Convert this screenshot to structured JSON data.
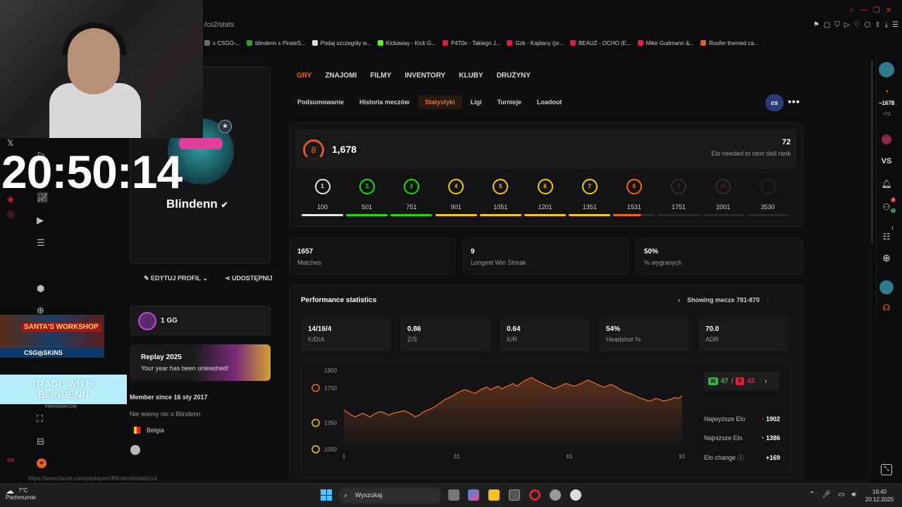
{
  "browser": {
    "address": "/cs2/stats",
    "bookmarks": [
      {
        "label": "x CSGO-...",
        "color": "#6e6e6e"
      },
      {
        "label": "blindenn x PirateS...",
        "color": "#3a9a3a"
      },
      {
        "label": "Podaj szczegóły w...",
        "color": "#dddddd"
      },
      {
        "label": "Kickaway - Kick G...",
        "color": "#53fc18"
      },
      {
        "label": "P4T0x - Takiego J...",
        "color": "#e0203a"
      },
      {
        "label": "Gzk - Kajdany (pr...",
        "color": "#e0203a"
      },
      {
        "label": "BEAUZ - OCHO (E...",
        "color": "#e0203a"
      },
      {
        "label": "Mike Gudmann &...",
        "color": "#e0203a"
      },
      {
        "label": "Roofer themed ca...",
        "color": "#e0632a"
      }
    ],
    "status_url": "https://www.faceit.com/pl/players/Blindenn/stats/cs2"
  },
  "overlay": {
    "clock": "20:50:14",
    "santa_title": "SANTA'S WORKSHOP",
    "csg_skins": "CSG◎SKINS",
    "trade_line1": "TRADE WITH:",
    "trade_line2": "BLINDENN",
    "trade_url": "PIRATESWAP.COM"
  },
  "profile": {
    "nickname": "Blindenn",
    "edit_label": "EDYTUJ PROFIL",
    "share_label": "UDOSTĘPNIJ",
    "gg_label": "1 GG",
    "replay_title": "Replay 2025",
    "replay_sub": "Your year has been unleashed!",
    "member_since": "Member since 16 sty 2017",
    "about": "Nie wiemy nic o Blindenn",
    "country": "Belgia"
  },
  "main_tabs": [
    {
      "label": "GRY",
      "active": true
    },
    {
      "label": "ZNAJOMI",
      "active": false
    },
    {
      "label": "FILMY",
      "active": false
    },
    {
      "label": "INVENTORY",
      "active": false
    },
    {
      "label": "KLUBY",
      "active": false
    },
    {
      "label": "DRUŻYNY",
      "active": false
    }
  ],
  "sub_tabs": [
    {
      "label": "Podsumowanie",
      "active": false
    },
    {
      "label": "Historia meczów",
      "active": false
    },
    {
      "label": "Statystyki",
      "active": true
    },
    {
      "label": "Ligi",
      "active": false
    },
    {
      "label": "Turnieje",
      "active": false
    },
    {
      "label": "Loadout",
      "active": false
    }
  ],
  "game_badge": "cs",
  "elo": {
    "level": "8",
    "value": "1,678",
    "needed": "72",
    "needed_label": "Elo needed to next skill rank",
    "levels": [
      {
        "lvl": "1",
        "elo": "100",
        "color": "#e8e8e8",
        "reached": true
      },
      {
        "lvl": "2",
        "elo": "501",
        "color": "#1ce400",
        "reached": true
      },
      {
        "lvl": "3",
        "elo": "751",
        "color": "#1ce400",
        "reached": true
      },
      {
        "lvl": "4",
        "elo": "901",
        "color": "#ffc800",
        "reached": true
      },
      {
        "lvl": "5",
        "elo": "1051",
        "color": "#ffc800",
        "reached": true
      },
      {
        "lvl": "6",
        "elo": "1201",
        "color": "#ffc800",
        "reached": true
      },
      {
        "lvl": "7",
        "elo": "1351",
        "color": "#ffc800",
        "reached": true
      },
      {
        "lvl": "8",
        "elo": "1531",
        "color": "#ff6309",
        "reached": true
      },
      {
        "lvl": "9",
        "elo": "1751",
        "color": "#ff6309",
        "reached": false
      },
      {
        "lvl": "10",
        "elo": "2001",
        "color": "#fe1f00",
        "reached": false
      },
      {
        "lvl": "",
        "elo": "3530",
        "color": "#555555",
        "reached": false
      }
    ],
    "progress_in_level8": 0.67
  },
  "summary": [
    {
      "value": "1657",
      "label": "Matches"
    },
    {
      "value": "9",
      "label": "Longest Win Streak"
    },
    {
      "value": "50%",
      "label": "% wygranych"
    }
  ],
  "performance": {
    "title": "Performance statistics",
    "showing": "Showing mecze 781-870",
    "stats": [
      {
        "value": "14/16/4",
        "label": "K/D/A"
      },
      {
        "value": "0.86",
        "label": "Z/Ś"
      },
      {
        "value": "0.64",
        "label": "K/R"
      },
      {
        "value": "54%",
        "label": "Headshot %"
      },
      {
        "value": "70.0",
        "label": "ADR"
      }
    ],
    "wins": "47",
    "losses": "43",
    "highest_label": "Najwyższe Elo",
    "highest": "1902",
    "lowest_label": "Najniższe Elo",
    "lowest": "1386",
    "change_label": "Elo change",
    "change": "+169"
  },
  "chart_data": {
    "type": "line",
    "x_ticks": [
      "1",
      "31",
      "61",
      "91"
    ],
    "y_ticks": [
      "1950",
      "1750",
      "1350",
      "1050"
    ],
    "ylim": [
      1050,
      1950
    ],
    "xlim": [
      1,
      91
    ],
    "color": "#e06a2a",
    "series": [
      {
        "values": [
          1500,
          1470,
          1440,
          1420,
          1440,
          1460,
          1440,
          1420,
          1450,
          1470,
          1480,
          1460,
          1440,
          1460,
          1470,
          1480,
          1490,
          1470,
          1450,
          1420,
          1440,
          1470,
          1490,
          1510,
          1530,
          1560,
          1590,
          1620,
          1640,
          1660,
          1690,
          1710,
          1730,
          1720,
          1700,
          1690,
          1720,
          1740,
          1760,
          1730,
          1750,
          1770,
          1740,
          1760,
          1780,
          1800,
          1770,
          1800,
          1830,
          1850,
          1870,
          1840,
          1820,
          1800,
          1780,
          1760,
          1740,
          1760,
          1780,
          1800,
          1790,
          1770,
          1780,
          1800,
          1820,
          1840,
          1820,
          1800,
          1780,
          1760,
          1770,
          1790,
          1770,
          1750,
          1720,
          1700,
          1690,
          1670,
          1650,
          1630,
          1620,
          1600,
          1610,
          1630,
          1620,
          1600,
          1610,
          1620,
          1640,
          1630,
          1660
        ]
      }
    ]
  },
  "right_sidebar": {
    "elo": "~1678",
    "elo_delta": "+72",
    "vs": "VS",
    "friend_badge": "2",
    "online_badge": "5",
    "party_badge": "1"
  },
  "taskbar": {
    "temp": "7°C",
    "weather": "Pochmurnie",
    "search": "Wyszukaj",
    "time": "16:40",
    "date": "20.12.2025"
  }
}
